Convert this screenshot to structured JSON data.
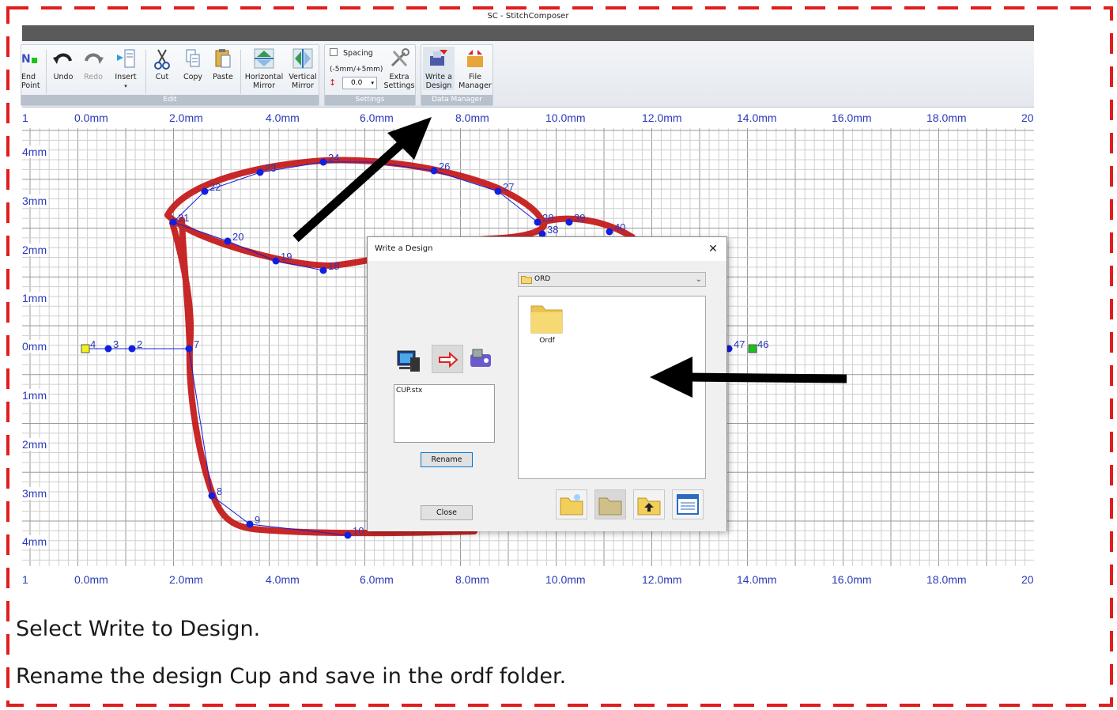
{
  "window": {
    "title": "SC - StitchComposer"
  },
  "ribbon": {
    "groups": {
      "edit": "Edit",
      "settings": "Settings",
      "data_manager": "Data Manager"
    },
    "buttons": {
      "end_point_line1": "End",
      "end_point_line2": "Point",
      "undo": "Undo",
      "redo": "Redo",
      "insert": "Insert",
      "cut": "Cut",
      "copy": "Copy",
      "paste": "Paste",
      "horizontal_mirror_line1": "Horizontal",
      "horizontal_mirror_line2": "Mirror",
      "vertical_mirror_line1": "Vertical",
      "vertical_mirror_line2": "Mirror",
      "spacing": "Spacing",
      "spacing_range": "(-5mm/+5mm)",
      "spacing_value": "0.0",
      "extra_settings_line1": "Extra",
      "extra_settings_line2": "Settings",
      "write_design_line1": "Write a",
      "write_design_line2": "Design",
      "file_manager_line1": "File",
      "file_manager_line2": "Manager"
    }
  },
  "rulers": {
    "x_labels": [
      "0.0mm",
      "2.0mm",
      "4.0mm",
      "6.0mm",
      "8.0mm",
      "10.0mm",
      "12.0mm",
      "14.0mm",
      "16.0mm",
      "18.0mm",
      "20"
    ],
    "left_partial": "1",
    "y_labels": [
      "4mm",
      "3mm",
      "2mm",
      "1mm",
      "0mm",
      "1mm",
      "2mm",
      "3mm",
      "4mm"
    ]
  },
  "points": {
    "labels": [
      "2",
      "3",
      "4",
      "7",
      "8",
      "9",
      "10",
      "18",
      "19",
      "20",
      "21",
      "22",
      "23",
      "24",
      "26",
      "27",
      "28",
      "39",
      "40",
      "38",
      "47",
      "46"
    ]
  },
  "dialog": {
    "title": "Write a Design",
    "folder": "ORD",
    "folder_item": "Ordf",
    "file": "CUP.stx",
    "rename": "Rename",
    "close": "Close"
  },
  "captions": {
    "line1": "Select Write to Design.",
    "line2": "Rename the design Cup and save in the ordf folder."
  },
  "colors": {
    "frame": "#e11d1d",
    "stitch": "#c31616",
    "point": "#1020e0",
    "axis_label": "#2a3ab8",
    "arrow": "#000000"
  }
}
